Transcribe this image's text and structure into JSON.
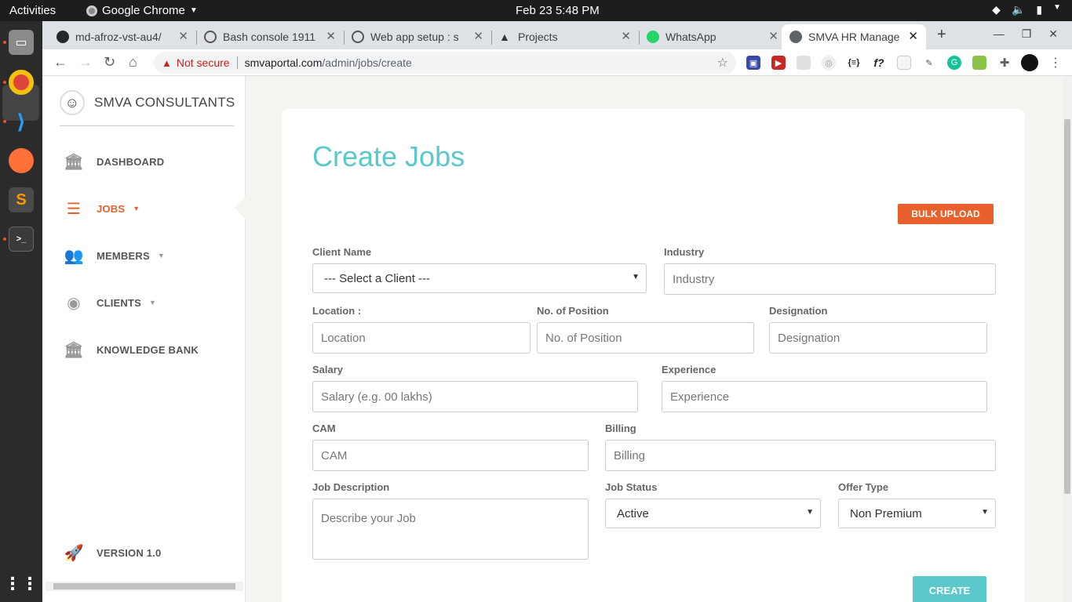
{
  "os": {
    "activities": "Activities",
    "app_name": "Google Chrome",
    "clock": "Feb 23   5:48 PM"
  },
  "browser": {
    "tabs": [
      {
        "title": "md-afroz-vst-au4/",
        "favicon": "github-icon"
      },
      {
        "title": "Bash console 1911",
        "favicon": "pythonanywhere-icon"
      },
      {
        "title": "Web app setup : s",
        "favicon": "pythonanywhere-icon"
      },
      {
        "title": "Projects",
        "favicon": "projects-icon"
      },
      {
        "title": "WhatsApp",
        "favicon": "whatsapp-icon"
      },
      {
        "title": "SMVA HR Manage",
        "favicon": "globe-icon"
      }
    ],
    "not_secure": "Not secure",
    "url_host": "smvaportal.com",
    "url_path": "/admin/jobs/create"
  },
  "sidebar": {
    "brand": "SMVA CONSULTANTS",
    "items": [
      {
        "label": "DASHBOARD",
        "icon": "bank-icon"
      },
      {
        "label": "JOBS",
        "icon": "list-icon"
      },
      {
        "label": "MEMBERS",
        "icon": "users-icon"
      },
      {
        "label": "CLIENTS",
        "icon": "user-circle-icon"
      },
      {
        "label": "KNOWLEDGE BANK",
        "icon": "bank-icon"
      }
    ],
    "version": "VERSION 1.0"
  },
  "form": {
    "title": "Create Jobs",
    "bulk_upload": "BULK UPLOAD",
    "client_name_label": "Client Name",
    "client_name_value": "--- Select a Client ---",
    "industry_label": "Industry",
    "industry_placeholder": "Industry",
    "location_label": "Location :",
    "location_placeholder": "Location",
    "positions_label": "No. of Position",
    "positions_placeholder": "No. of Position",
    "designation_label": "Designation",
    "designation_placeholder": "Designation",
    "salary_label": "Salary",
    "salary_placeholder": "Salary (e.g. 00 lakhs)",
    "experience_label": "Experience",
    "experience_placeholder": "Experience",
    "cam_label": "CAM",
    "cam_placeholder": "CAM",
    "billing_label": "Billing",
    "billing_placeholder": "Billing",
    "description_label": "Job Description",
    "description_placeholder": "Describe your Job",
    "status_label": "Job Status",
    "status_value": "Active",
    "offer_label": "Offer Type",
    "offer_value": "Non Premium",
    "create": "CREATE"
  }
}
